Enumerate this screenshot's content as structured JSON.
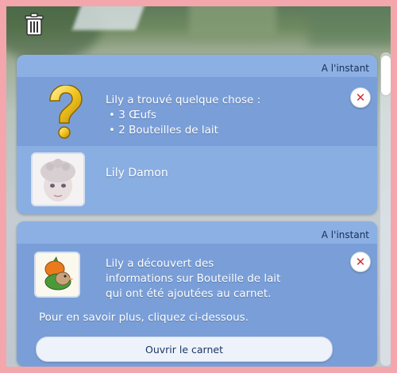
{
  "trash": {
    "icon": "trash-icon"
  },
  "notifications": [
    {
      "timestamp": "A l'instant",
      "heading": "Lily a trouvé quelque chose :",
      "items": [
        "3 Œufs",
        "2 Bouteilles de lait"
      ],
      "sim_name": "Lily Damon",
      "close_glyph": "✕"
    },
    {
      "timestamp": "A l'instant",
      "lines": [
        "Lily a découvert des",
        "informations sur Bouteille de lait",
        "qui ont été ajoutées au carnet."
      ],
      "more_info": "Pour en savoir plus, cliquez ci-dessous.",
      "button_label": "Ouvrir le carnet",
      "close_glyph": "✕"
    }
  ]
}
